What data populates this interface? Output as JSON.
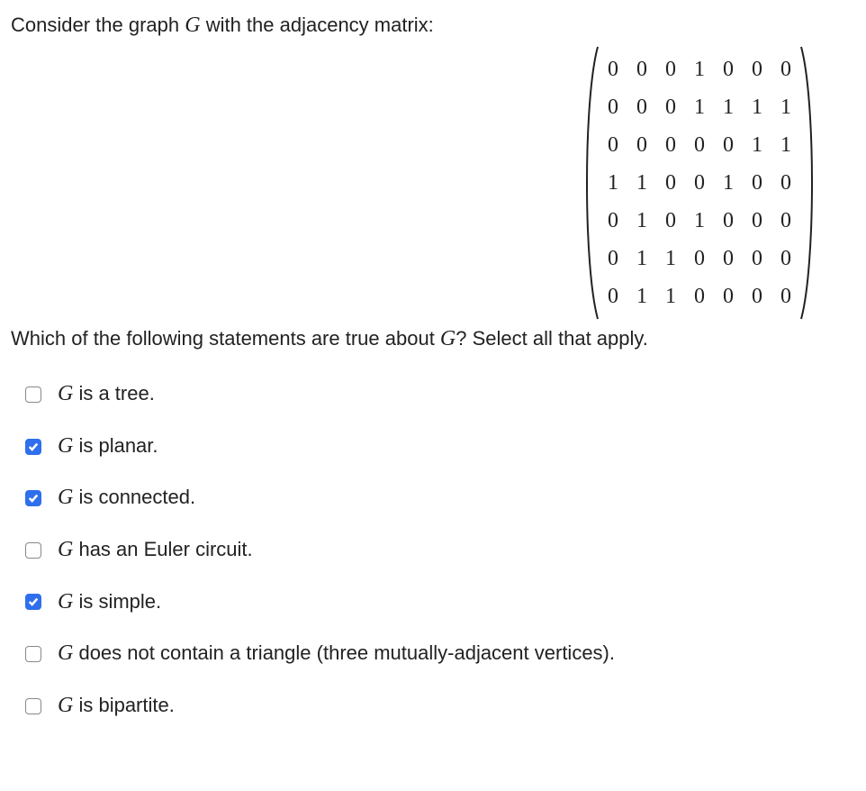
{
  "intro_pre": "Consider the graph ",
  "intro_var": "G",
  "intro_post": " with the adjacency matrix:",
  "matrix": [
    [
      "0",
      "0",
      "0",
      "1",
      "0",
      "0",
      "0"
    ],
    [
      "0",
      "0",
      "0",
      "1",
      "1",
      "1",
      "1"
    ],
    [
      "0",
      "0",
      "0",
      "0",
      "0",
      "1",
      "1"
    ],
    [
      "1",
      "1",
      "0",
      "0",
      "1",
      "0",
      "0"
    ],
    [
      "0",
      "1",
      "0",
      "1",
      "0",
      "0",
      "0"
    ],
    [
      "0",
      "1",
      "1",
      "0",
      "0",
      "0",
      "0"
    ],
    [
      "0",
      "1",
      "1",
      "0",
      "0",
      "0",
      "0"
    ]
  ],
  "question_pre": "Which of the following statements are true about ",
  "question_var": "G",
  "question_post": "? Select all that apply.",
  "options": [
    {
      "id": "opt-tree",
      "checked": false,
      "var": "G",
      "text": " is a tree."
    },
    {
      "id": "opt-planar",
      "checked": true,
      "var": "G",
      "text": " is planar."
    },
    {
      "id": "opt-connected",
      "checked": true,
      "var": "G",
      "text": " is connected."
    },
    {
      "id": "opt-euler",
      "checked": false,
      "var": "G",
      "text": " has an Euler circuit."
    },
    {
      "id": "opt-simple",
      "checked": true,
      "var": "G",
      "text": " is simple."
    },
    {
      "id": "opt-triangle",
      "checked": false,
      "var": "G",
      "text": " does not contain a triangle (three mutually-adjacent vertices)."
    },
    {
      "id": "opt-bipartite",
      "checked": false,
      "var": "G",
      "text": " is bipartite."
    }
  ]
}
